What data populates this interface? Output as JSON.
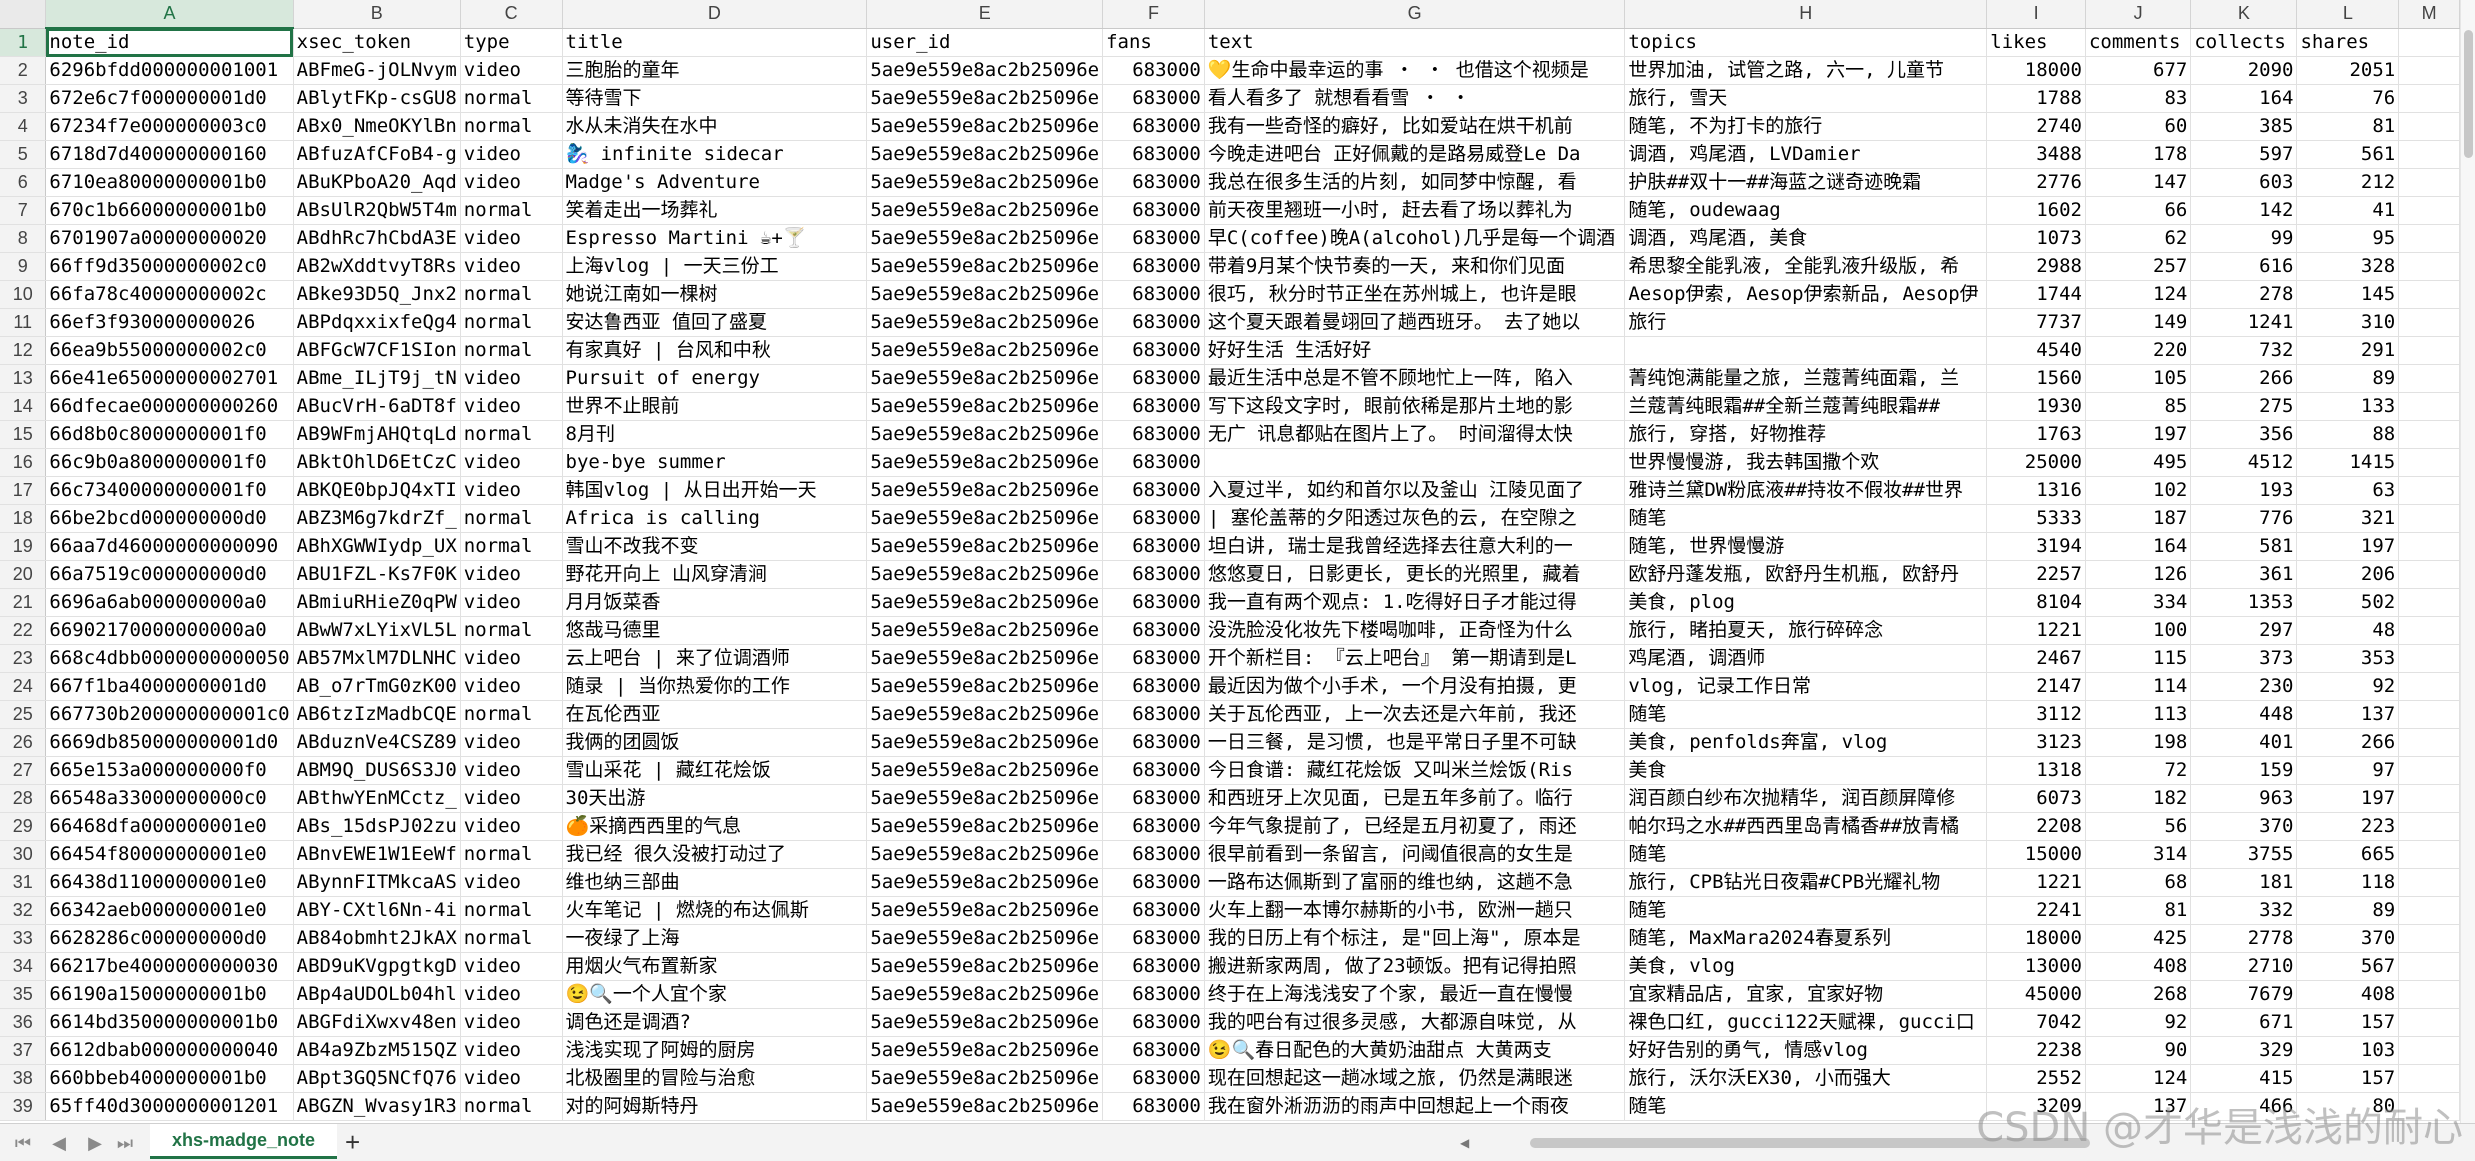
{
  "sheet_tab": "xhs-madge_note",
  "watermark": "CSDN @才华是浅浅的耐心",
  "column_letters": [
    "A",
    "B",
    "C",
    "D",
    "E",
    "F",
    "G",
    "H",
    "I",
    "J",
    "K",
    "L",
    "M"
  ],
  "headers": [
    "note_id",
    "xsec_token",
    "type",
    "title",
    "user_id",
    "fans",
    "text",
    "topics",
    "likes",
    "comments",
    "collects",
    "shares"
  ],
  "rows": [
    [
      "6296bfdd000000001001",
      "ABFmeG-jOLNvym",
      "video",
      "三胞胎的童年",
      "5ae9e559e8ac2b25096e",
      "683000",
      "💛生命中最幸运的事 ・ ・ 也借这个视频是",
      "世界加油, 试管之路, 六一, 儿童节",
      "18000",
      "677",
      "2090",
      "2051"
    ],
    [
      "672e6c7f000000001d0",
      "ABlytFKp-csGU8",
      "normal",
      "等待雪下",
      "5ae9e559e8ac2b25096e",
      "683000",
      "看人看多了 就想看看雪 ・ ・",
      "旅行, 雪天",
      "1788",
      "83",
      "164",
      "76"
    ],
    [
      "67234f7e000000003c0",
      "ABx0_NmeOKYlBn",
      "normal",
      "水从未消失在水中",
      "5ae9e559e8ac2b25096e",
      "683000",
      "我有一些奇怪的癖好, 比如爱站在烘干机前",
      "随笔, 不为打卡的旅行",
      "2740",
      "60",
      "385",
      "81"
    ],
    [
      "6718d7d400000000160",
      "ABfuzAfCFoB4-g",
      "video",
      "🧞‍♀️ infinite sidecar",
      "5ae9e559e8ac2b25096e",
      "683000",
      "今晚走进吧台 正好佩戴的是路易威登Le Da",
      "调酒, 鸡尾酒, LVDamier",
      "3488",
      "178",
      "597",
      "561"
    ],
    [
      "6710ea80000000001b0",
      "ABuKPboA20_Aqd",
      "video",
      "Madge's Adventure",
      "5ae9e559e8ac2b25096e",
      "683000",
      "我总在很多生活的片刻, 如同梦中惊醒, 看",
      "护肤##双十一##海蓝之谜奇迹晚霜",
      "2776",
      "147",
      "603",
      "212"
    ],
    [
      "670c1b66000000001b0",
      "ABsUlR2QbW5T4m",
      "normal",
      "笑着走出一场葬礼",
      "5ae9e559e8ac2b25096e",
      "683000",
      "前天夜里翘班一小时, 赶去看了场以葬礼为",
      "随笔, oudewaag",
      "1602",
      "66",
      "142",
      "41"
    ],
    [
      "6701907a00000000020",
      "ABdhRc7hCbdA3E",
      "video",
      "Espresso Martini ☕+🍸",
      "5ae9e559e8ac2b25096e",
      "683000",
      "早C(coffee)晚A(alcohol)几乎是每一个调酒",
      "调酒, 鸡尾酒, 美食",
      "1073",
      "62",
      "99",
      "95"
    ],
    [
      "66ff9d35000000002c0",
      "AB2wXddtvyT8Rs",
      "video",
      "上海vlog | 一天三份工",
      "5ae9e559e8ac2b25096e",
      "683000",
      "带着9月某个快节奏的一天, 来和你们见面",
      "希思黎全能乳液, 全能乳液升级版, 希",
      "2988",
      "257",
      "616",
      "328"
    ],
    [
      "66fa78c40000000002c",
      "ABke93D5Q_Jnx2",
      "normal",
      "她说江南如一棵树",
      "5ae9e559e8ac2b25096e",
      "683000",
      "很巧, 秋分时节正坐在苏州城上, 也许是眼",
      "Aesop伊索, Aesop伊索新品, Aesop伊",
      "1744",
      "124",
      "278",
      "145"
    ],
    [
      "66ef3f930000000026",
      "ABPdqxxixfeQg4",
      "normal",
      "安达鲁西亚 值回了盛夏",
      "5ae9e559e8ac2b25096e",
      "683000",
      "这个夏天跟着曼翊回了趟西班牙。 去了她以",
      "旅行",
      "7737",
      "149",
      "1241",
      "310"
    ],
    [
      "66ea9b55000000002c0",
      "ABFGcW7CF1SIon",
      "normal",
      "有家真好 | 台风和中秋",
      "5ae9e559e8ac2b25096e",
      "683000",
      "好好生活 生活好好",
      "",
      "4540",
      "220",
      "732",
      "291"
    ],
    [
      "66e41e65000000002701",
      "ABme_ILjT9j_tN",
      "video",
      "Pursuit of energy",
      "5ae9e559e8ac2b25096e",
      "683000",
      "最近生活中总是不管不顾地忙上一阵, 陷入",
      "菁纯饱满能量之旅, 兰蔻菁纯面霜, 兰",
      "1560",
      "105",
      "266",
      "89"
    ],
    [
      "66dfecae000000000260",
      "ABucVrH-6aDT8f",
      "video",
      "世界不止眼前",
      "5ae9e559e8ac2b25096e",
      "683000",
      "写下这段文字时, 眼前依稀是那片土地的影",
      "兰蔻菁纯眼霜##全新兰蔻菁纯眼霜##",
      "1930",
      "85",
      "275",
      "133"
    ],
    [
      "66d8b0c8000000001f0",
      "AB9WFmjAHQtqLd",
      "normal",
      "8月刊",
      "5ae9e559e8ac2b25096e",
      "683000",
      "无广 讯息都贴在图片上了。 时间溜得太快",
      "旅行, 穿搭, 好物推荐",
      "1763",
      "197",
      "356",
      "88"
    ],
    [
      "66c9b0a8000000001f0",
      "ABktOhlD6EtCzC",
      "video",
      "bye-bye summer",
      "5ae9e559e8ac2b25096e",
      "683000",
      "",
      "世界慢慢游, 我去韩国撒个欢",
      "25000",
      "495",
      "4512",
      "1415"
    ],
    [
      "66c73400000000001f0",
      "ABKQE0bpJQ4xTI",
      "video",
      "韩国vlog | 从日出开始一天",
      "5ae9e559e8ac2b25096e",
      "683000",
      "入夏过半, 如约和首尔以及釜山 江陵见面了",
      "雅诗兰黛DW粉底液##持妆不假妆##世界",
      "1316",
      "102",
      "193",
      "63"
    ],
    [
      "66be2bcd000000000d0",
      "ABZ3M6g7kdrZf_",
      "normal",
      "Africa is calling",
      "5ae9e559e8ac2b25096e",
      "683000",
      "| 塞伦盖蒂的夕阳透过灰色的云, 在空隙之",
      "随笔",
      "5333",
      "187",
      "776",
      "321"
    ],
    [
      "66aa7d46000000000090",
      "ABhXGWWIydp_UX",
      "normal",
      "雪山不改我不变",
      "5ae9e559e8ac2b25096e",
      "683000",
      "坦白讲, 瑞士是我曾经选择去往意大利的一",
      "随笔, 世界慢慢游",
      "3194",
      "164",
      "581",
      "197"
    ],
    [
      "66a7519c000000000d0",
      "ABU1FZL-Ks7F0K",
      "video",
      "野花开向上 山风穿清涧",
      "5ae9e559e8ac2b25096e",
      "683000",
      "悠悠夏日, 日影更长, 更长的光照里, 藏着",
      "欧舒丹蓬发瓶, 欧舒丹生机瓶, 欧舒丹",
      "2257",
      "126",
      "361",
      "206"
    ],
    [
      "6696a6ab000000000a0",
      "ABmiuRHieZ0qPW",
      "video",
      "月月饭菜香",
      "5ae9e559e8ac2b25096e",
      "683000",
      "我一直有两个观点: 1.吃得好日子才能过得",
      "美食, plog",
      "8104",
      "334",
      "1353",
      "502"
    ],
    [
      "66902170000000000a0",
      "ABwW7xLYixVL5L",
      "normal",
      "悠哉马德里",
      "5ae9e559e8ac2b25096e",
      "683000",
      "没洗脸没化妆先下楼喝咖啡, 正奇怪为什么",
      "旅行, 睹拍夏天, 旅行碎碎念",
      "1221",
      "100",
      "297",
      "48"
    ],
    [
      "668c4dbb0000000000050",
      "AB57MxlM7DLNHC",
      "video",
      "云上吧台 | 来了位调酒师",
      "5ae9e559e8ac2b25096e",
      "683000",
      "开个新栏目: 『云上吧台』 第一期请到是L",
      "鸡尾酒, 调酒师",
      "2467",
      "115",
      "373",
      "353"
    ],
    [
      "667f1ba4000000001d0",
      "AB_o7rTmG0zK00",
      "video",
      "随录 | 当你热爱你的工作",
      "5ae9e559e8ac2b25096e",
      "683000",
      "最近因为做个小手术, 一个月没有拍摄, 更",
      "vlog, 记录工作日常",
      "2147",
      "114",
      "230",
      "92"
    ],
    [
      "667730b200000000001c0",
      "AB6tzIzMadbCQE",
      "normal",
      "在瓦伦西亚",
      "5ae9e559e8ac2b25096e",
      "683000",
      "关于瓦伦西亚, 上一次去还是六年前, 我还",
      "随笔",
      "3112",
      "113",
      "448",
      "137"
    ],
    [
      "6669db850000000001d0",
      "ABduznVe4CSZ89",
      "video",
      "我俩的团圆饭",
      "5ae9e559e8ac2b25096e",
      "683000",
      "一日三餐, 是习惯, 也是平常日子里不可缺",
      "美食, penfolds奔富, vlog",
      "3123",
      "198",
      "401",
      "266"
    ],
    [
      "665e153a000000000f0",
      "ABM9Q_DUS6S3J0",
      "video",
      "雪山采花 | 藏红花烩饭",
      "5ae9e559e8ac2b25096e",
      "683000",
      "今日食谱: 藏红花烩饭 又叫米兰烩饭(Ris",
      "美食",
      "1318",
      "72",
      "159",
      "97"
    ],
    [
      "66548a33000000000c0",
      "ABthwYEnMCctz_",
      "video",
      "30天出游",
      "5ae9e559e8ac2b25096e",
      "683000",
      "和西班牙上次见面, 已是五年多前了。临行",
      "润百颜白纱布次抛精华, 润百颜屏障修",
      "6073",
      "182",
      "963",
      "197"
    ],
    [
      "66468dfa000000001e0",
      "ABs_15dsPJ02zu",
      "video",
      "🍊采摘西西里的气息",
      "5ae9e559e8ac2b25096e",
      "683000",
      "今年气象提前了, 已经是五月初夏了, 雨还",
      "帕尔玛之水##西西里岛青橘香##放青橘",
      "2208",
      "56",
      "370",
      "223"
    ],
    [
      "66454f80000000001e0",
      "ABnvEWE1W1EeWf",
      "normal",
      "我已经 很久没被打动过了",
      "5ae9e559e8ac2b25096e",
      "683000",
      "很早前看到一条留言, 问阈值很高的女生是",
      "随笔",
      "15000",
      "314",
      "3755",
      "665"
    ],
    [
      "66438d11000000001e0",
      "ABynnFITMkcaAS",
      "video",
      "维也纳三部曲",
      "5ae9e559e8ac2b25096e",
      "683000",
      "一路布达佩斯到了富丽的维也纳, 这趟不急",
      "旅行, CPB钻光日夜霜#CPB光耀礼物",
      "1221",
      "68",
      "181",
      "118"
    ],
    [
      "66342aeb000000001e0",
      "ABY-CXtl6Nn-4i",
      "normal",
      "火车笔记 | 燃烧的布达佩斯",
      "5ae9e559e8ac2b25096e",
      "683000",
      "火车上翻一本博尔赫斯的小书, 欧洲一趟只",
      "随笔",
      "2241",
      "81",
      "332",
      "89"
    ],
    [
      "6628286c000000000d0",
      "AB84obmht2JkAX",
      "normal",
      "一夜绿了上海",
      "5ae9e559e8ac2b25096e",
      "683000",
      "我的日历上有个标注, 是\"回上海\", 原本是",
      "随笔, MaxMara2024春夏系列",
      "18000",
      "425",
      "2778",
      "370"
    ],
    [
      "66217be4000000000030",
      "ABD9uKVgpgtkgD",
      "video",
      "用烟火气布置新家",
      "5ae9e559e8ac2b25096e",
      "683000",
      "搬进新家两周, 做了23顿饭。把有记得拍照",
      "美食, vlog",
      "13000",
      "408",
      "2710",
      "567"
    ],
    [
      "66190a15000000001b0",
      "ABp4aUDOLb04hl",
      "video",
      "😉🔍一个人宜个家",
      "5ae9e559e8ac2b25096e",
      "683000",
      "终于在上海浅浅安了个家, 最近一直在慢慢",
      "宜家精品店, 宜家, 宜家好物",
      "45000",
      "268",
      "7679",
      "408"
    ],
    [
      "6614bd350000000001b0",
      "ABGFdiXwxv48en",
      "video",
      "调色还是调酒?",
      "5ae9e559e8ac2b25096e",
      "683000",
      "我的吧台有过很多灵感, 大都源自味觉, 从",
      "裸色口红, gucci122天赋裸, gucci口",
      "7042",
      "92",
      "671",
      "157"
    ],
    [
      "6612dbab000000000040",
      "AB4a9ZbzM515QZ",
      "video",
      "浅浅实现了阿姆的厨房",
      "5ae9e559e8ac2b25096e",
      "683000",
      "😉🔍春日配色的大黄奶油甜点 大黄两支",
      "好好告别的勇气, 情感vlog",
      "2238",
      "90",
      "329",
      "103"
    ],
    [
      "660bbeb4000000001b0",
      "ABpt3GQ5NCfQ76",
      "video",
      "北极圈里的冒险与治愈",
      "5ae9e559e8ac2b25096e",
      "683000",
      "现在回想起这一趟冰域之旅, 仍然是满眼迷",
      "旅行, 沃尔沃EX30, 小而强大",
      "2552",
      "124",
      "415",
      "157"
    ],
    [
      "65ff40d3000000001201",
      "ABGZN_Wvasy1R3",
      "normal",
      "对的阿姆斯特丹",
      "5ae9e559e8ac2b25096e",
      "683000",
      "我在窗外淅沥沥的雨声中回想起上一个雨夜",
      "随笔",
      "3209",
      "137",
      "466",
      "80"
    ]
  ]
}
